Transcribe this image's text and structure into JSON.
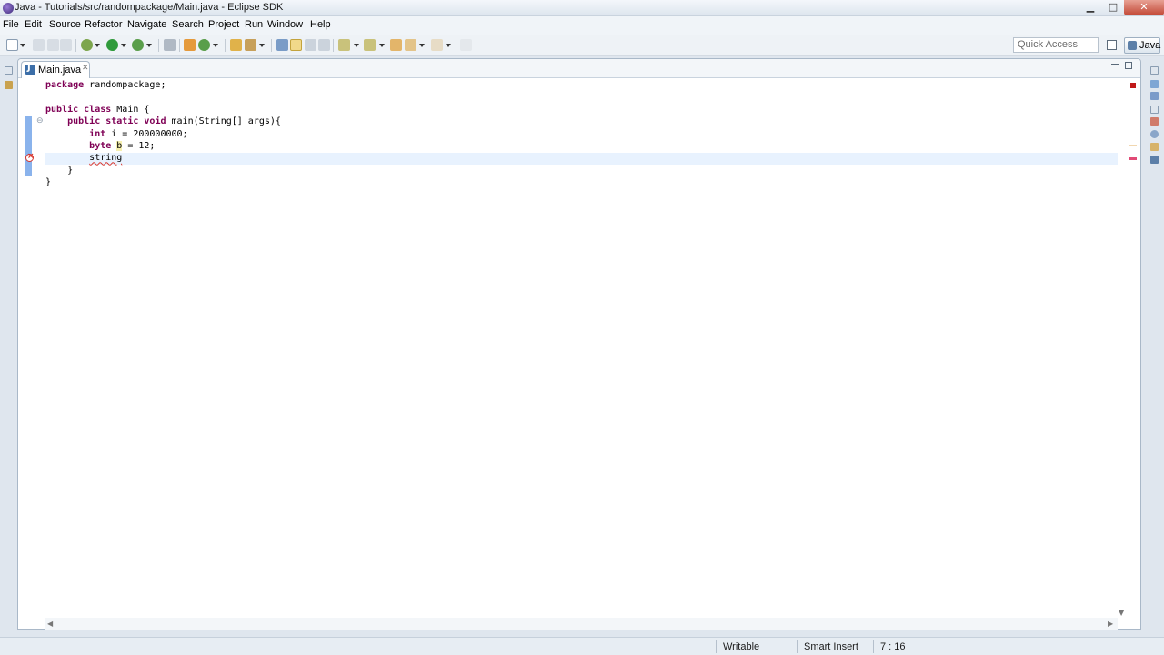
{
  "window": {
    "title": "Java - Tutorials/src/randompackage/Main.java - Eclipse SDK",
    "minimize": "▁",
    "maximize": "□",
    "close": "✕"
  },
  "menu": [
    "File",
    "Edit",
    "Source",
    "Refactor",
    "Navigate",
    "Search",
    "Project",
    "Run",
    "Window",
    "Help"
  ],
  "toolbar": {
    "quick_access_placeholder": "Quick Access",
    "perspective_label": "Java"
  },
  "editor": {
    "tab_label": "Main.java",
    "tab_close": "✕",
    "code": {
      "line1_kw": "package",
      "line1_rest": " randompackage;",
      "line3_kw1": "public",
      "line3_kw2": "class",
      "line3_rest": " Main {",
      "line4_kw1": "public",
      "line4_kw2": "static",
      "line4_kw3": "void",
      "line4_rest": " main(String[] args){",
      "line5_kw": "int",
      "line5_rest": " i = 200000000;",
      "line6_kw": "byte",
      "line6_var": "b",
      "line6_rest": " = 12;",
      "line7_text": "string",
      "line8_text": "}",
      "line9_text": "}"
    }
  },
  "status": {
    "writable": "Writable",
    "insert_mode": "Smart Insert",
    "position": "7 : 16"
  },
  "colors": {
    "keyword": "#7f0055",
    "error": "#d9342b",
    "current_line": "#e8f2fe",
    "change_bar": "#8ab3ec"
  }
}
